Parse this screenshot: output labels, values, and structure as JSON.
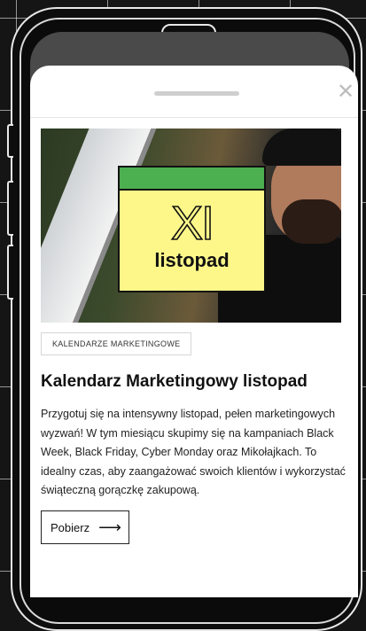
{
  "card": {
    "image_alt": "",
    "calendar": {
      "number": "XI",
      "month": "listopad"
    },
    "tag": "KALENDARZE MARKETINGOWE",
    "title": "Kalendarz Marketingowy listopad",
    "description": "Przygotuj się na intensywny listopad, pełen marketingowych wyzwań! W tym miesiącu skupimy się na kampaniach Black Week, Black Friday, Cyber Monday oraz Mikołajkach. To idealny czas, aby zaangażować swoich klientów i wykorzystać świąteczną gorączkę zakupową.",
    "button_label": "Pobierz",
    "button_icon": "arrow-right-icon"
  },
  "sheet": {
    "close_icon": "close-icon"
  },
  "colors": {
    "calendar_yellow": "#fdf78a",
    "calendar_green": "#4caf50",
    "background": "#151515"
  }
}
